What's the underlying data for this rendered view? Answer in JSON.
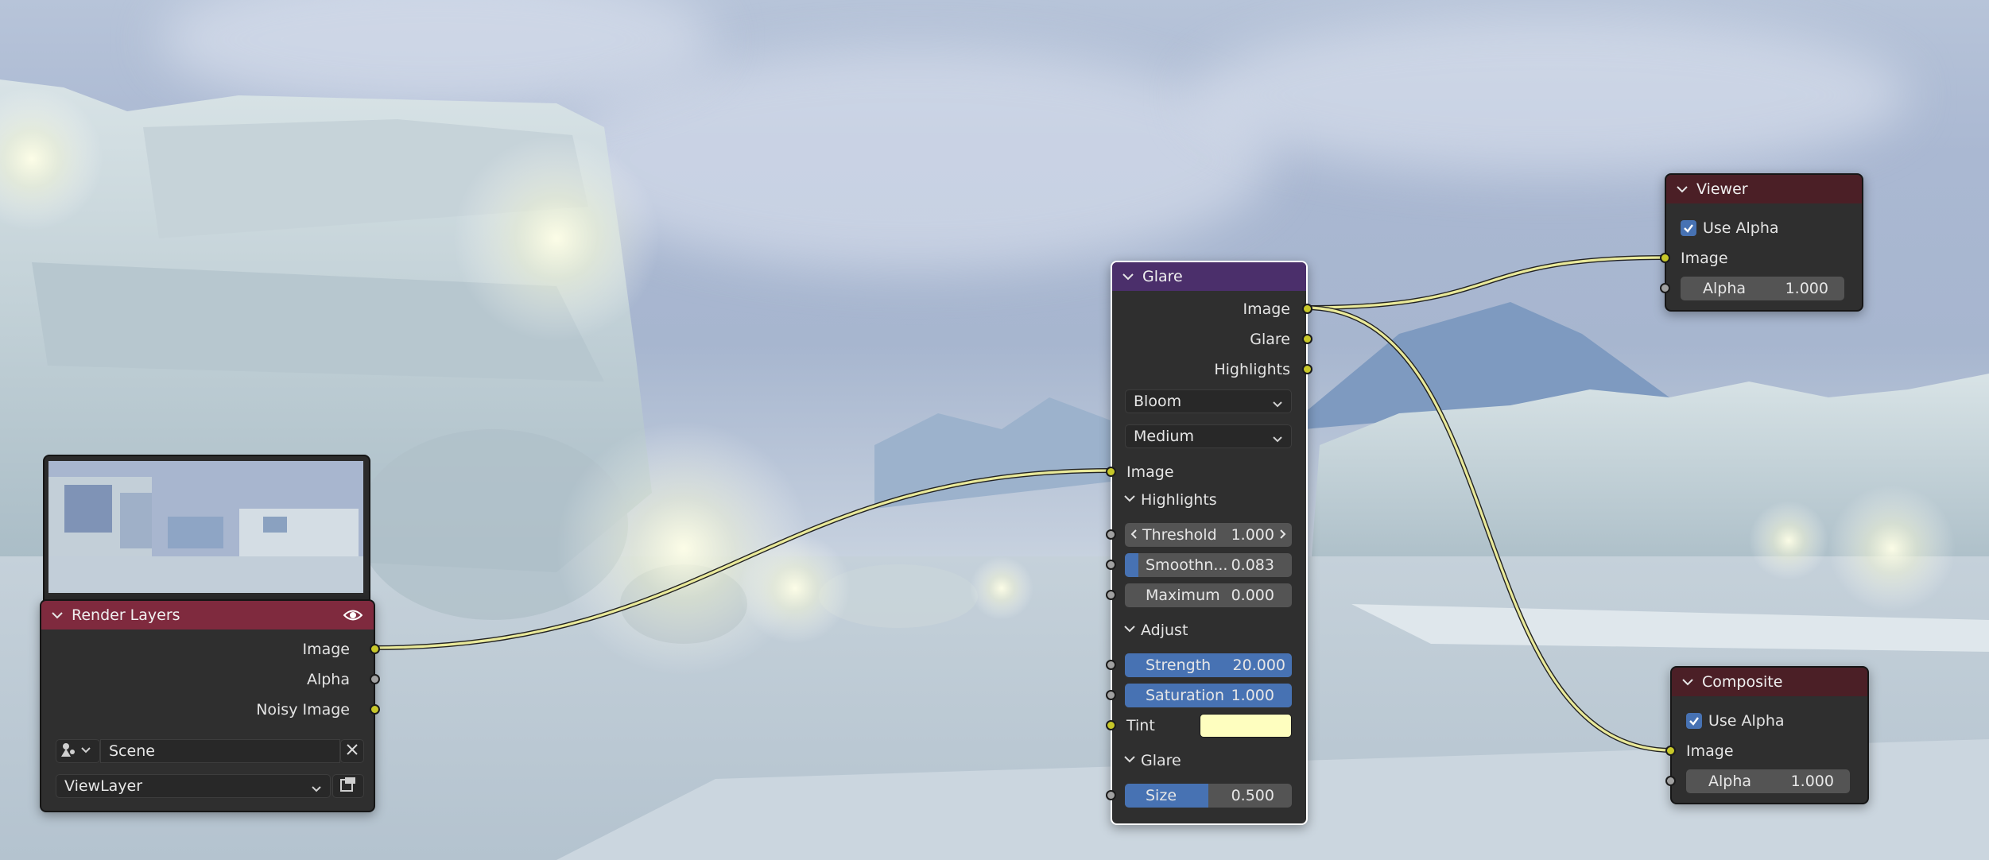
{
  "nodes": {
    "render_layers": {
      "title": "Render Layers",
      "outputs": [
        "Image",
        "Alpha",
        "Noisy Image"
      ],
      "scene": "Scene",
      "view_layer": "ViewLayer"
    },
    "glare": {
      "title": "Glare",
      "outputs": [
        "Image",
        "Glare",
        "Highlights"
      ],
      "glare_type": "Bloom",
      "quality": "Medium",
      "input_image": "Image",
      "highlights_panel": "Highlights",
      "threshold": {
        "label": "Threshold",
        "value": "1.000"
      },
      "smoothness": {
        "label": "Smoothn...",
        "value": "0.083",
        "fraction": 0.083
      },
      "maximum": {
        "label": "Maximum",
        "value": "0.000",
        "fraction": 0.0
      },
      "adjust_panel": "Adjust",
      "strength": {
        "label": "Strength",
        "value": "20.000",
        "fraction": 1.0
      },
      "saturation": {
        "label": "Saturation",
        "value": "1.000",
        "fraction": 1.0
      },
      "tint": {
        "label": "Tint",
        "color": "#fefebf"
      },
      "glare_panel": "Glare",
      "size": {
        "label": "Size",
        "value": "0.500",
        "fraction": 0.5
      }
    },
    "viewer": {
      "title": "Viewer",
      "use_alpha": "Use Alpha",
      "input_image": "Image",
      "alpha": {
        "label": "Alpha",
        "value": "1.000"
      }
    },
    "composite": {
      "title": "Composite",
      "use_alpha": "Use Alpha",
      "input_image": "Image",
      "alpha": {
        "label": "Alpha",
        "value": "1.000"
      }
    }
  },
  "colors": {
    "input_header": "#7f2a3e",
    "filter_header": "#4b2f6b",
    "output_header": "#4b1f26",
    "socket_color": "#c7c729",
    "socket_value": "#a1a1a1",
    "field_fill": "#4772b3",
    "link": "#e9e99a"
  }
}
